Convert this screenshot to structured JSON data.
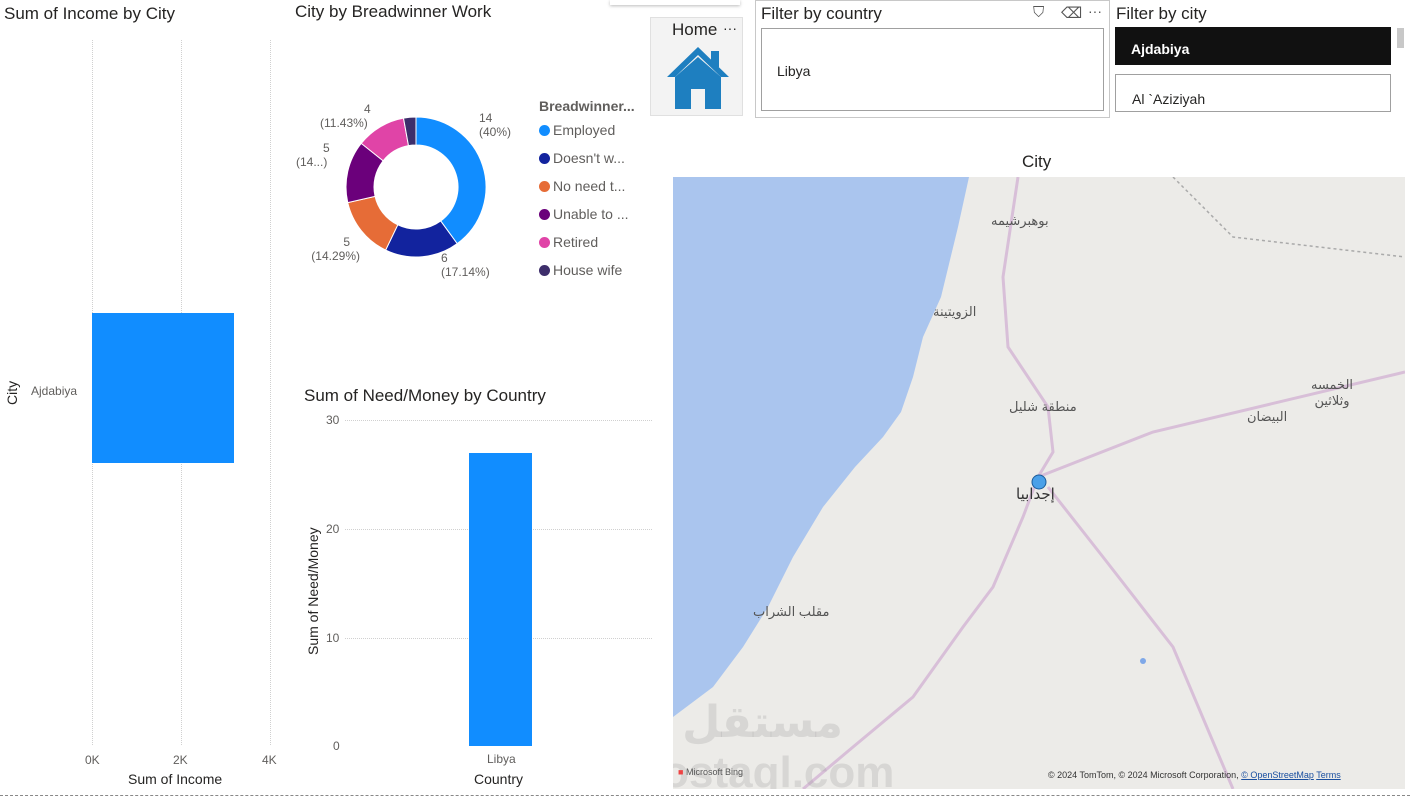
{
  "income_chart": {
    "title": "Sum of Income by City",
    "ylabel": "City",
    "xlabel": "Sum of Income",
    "x_ticks": [
      "0K",
      "2K",
      "4K"
    ]
  },
  "donut_chart": {
    "title": "City by Breadwinner Work",
    "legend_title": "Breadwinner...",
    "labels": [
      {
        "value": "14",
        "pct": "(40%)"
      },
      {
        "value": "6",
        "pct": "(17.14%)"
      },
      {
        "value": "5",
        "pct": "(14.29%)"
      },
      {
        "value": "5",
        "pct": "(14...)"
      },
      {
        "value": "4",
        "pct": "(11.43%)"
      }
    ]
  },
  "need_chart": {
    "title": "Sum of Need/Money by Country",
    "ylabel": "Sum of Need/Money",
    "xlabel": "Country",
    "y_ticks": [
      "30",
      "20",
      "10",
      "0"
    ]
  },
  "chart_data": [
    {
      "type": "bar",
      "orientation": "horizontal",
      "title": "Sum of Income by City",
      "categories": [
        "Ajdabiya"
      ],
      "values": [
        3200
      ],
      "xlabel": "Sum of Income",
      "ylabel": "City",
      "xlim": [
        0,
        4000
      ],
      "color": "#118dff"
    },
    {
      "type": "pie",
      "donut": true,
      "title": "City by Breadwinner Work",
      "legend_title": "Breadwinner...",
      "categories": [
        "Employed",
        "Doesn't w...",
        "No need t...",
        "Unable to ...",
        "Retired",
        "House wife"
      ],
      "values": [
        14,
        6,
        5,
        5,
        4,
        1
      ],
      "colors": [
        "#118dff",
        "#12239e",
        "#e66c37",
        "#6b007b",
        "#e044a7",
        "#3d2e6b"
      ],
      "legend_placement": "right"
    },
    {
      "type": "bar",
      "title": "Sum of Need/Money by Country",
      "categories": [
        "Libya"
      ],
      "values": [
        27
      ],
      "xlabel": "Country",
      "ylabel": "Sum of Need/Money",
      "ylim": [
        0,
        30
      ],
      "color": "#118dff"
    }
  ],
  "home_button": {
    "label": "Home",
    "more": "···"
  },
  "country_filter": {
    "title": "Filter by country",
    "selected": "Libya"
  },
  "city_filter": {
    "title": "Filter by city",
    "items": [
      "Ajdabiya",
      "Al `Aziziyah"
    ]
  },
  "map": {
    "title": "City",
    "labels": [
      "بوهبرشيمه",
      "الزويتينة",
      "منطقة شليل",
      "البيضان",
      "الخمسه وثلاثين",
      "إجدابيا",
      "مقلب الشراب"
    ],
    "attribution": "© 2024 TomTom, © 2024 Microsoft Corporation, ",
    "osm": "© OpenStreetMap",
    "terms": "Terms",
    "bing": "Microsoft Bing"
  },
  "watermark": "مستقل mostaql.com"
}
